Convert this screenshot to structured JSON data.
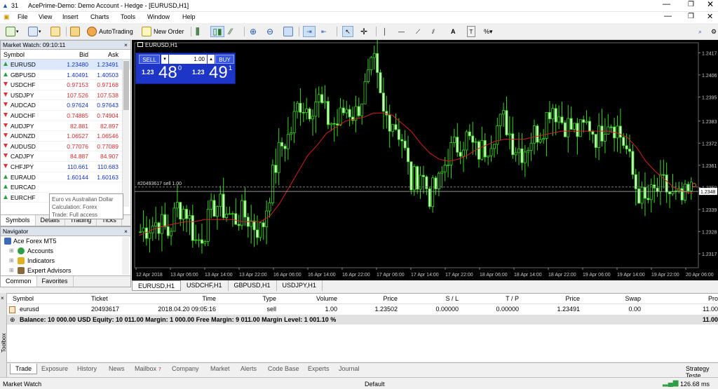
{
  "window": {
    "title": "AcePrime-Demo: Demo Account - Hedge - [EURUSD,H1]",
    "app_badge": "31"
  },
  "menu": [
    "File",
    "View",
    "Insert",
    "Charts",
    "Tools",
    "Window",
    "Help"
  ],
  "toolbar": {
    "autotrading": "AutoTrading",
    "new_order": "New Order"
  },
  "market_watch": {
    "title": "Market Watch: 09:10:11",
    "columns": {
      "symbol": "Symbol",
      "bid": "Bid",
      "ask": "Ask"
    },
    "rows": [
      {
        "symbol": "EURUSD",
        "bid": "1.23480",
        "ask": "1.23491",
        "dir": "up",
        "color": "blue"
      },
      {
        "symbol": "GBPUSD",
        "bid": "1.40491",
        "ask": "1.40503",
        "dir": "up",
        "color": "blue"
      },
      {
        "symbol": "USDCHF",
        "bid": "0.97153",
        "ask": "0.97168",
        "dir": "dn",
        "color": "red"
      },
      {
        "symbol": "USDJPY",
        "bid": "107.526",
        "ask": "107.538",
        "dir": "dn",
        "color": "red"
      },
      {
        "symbol": "AUDCAD",
        "bid": "0.97624",
        "ask": "0.97643",
        "dir": "dn",
        "color": "blue"
      },
      {
        "symbol": "AUDCHF",
        "bid": "0.74885",
        "ask": "0.74904",
        "dir": "dn",
        "color": "red"
      },
      {
        "symbol": "AUDJPY",
        "bid": "82.881",
        "ask": "82.897",
        "dir": "dn",
        "color": "red"
      },
      {
        "symbol": "AUDNZD",
        "bid": "1.06527",
        "ask": "1.06546",
        "dir": "dn",
        "color": "red"
      },
      {
        "symbol": "AUDUSD",
        "bid": "0.77076",
        "ask": "0.77089",
        "dir": "dn",
        "color": "red"
      },
      {
        "symbol": "CADJPY",
        "bid": "84.887",
        "ask": "84.907",
        "dir": "dn",
        "color": "red"
      },
      {
        "symbol": "CHFJPY",
        "bid": "110.661",
        "ask": "110.683",
        "dir": "dn",
        "color": "blue"
      },
      {
        "symbol": "EURAUD",
        "bid": "1.60144",
        "ask": "1.60163",
        "dir": "up",
        "color": "blue"
      },
      {
        "symbol": "EURCAD",
        "bid": "",
        "ask": "",
        "dir": "up",
        "color": "blue"
      },
      {
        "symbol": "EURCHF",
        "bid": "",
        "ask": "",
        "dir": "up",
        "color": "blue"
      }
    ],
    "tabs": [
      "Symbols",
      "Details",
      "Trading",
      "Ticks"
    ],
    "tooltip": [
      "Euro vs Australian Dollar",
      "Calculation: Forex",
      "Trade: Full access"
    ]
  },
  "navigator": {
    "title": "Navigator",
    "items": [
      "Ace Forex MT5",
      "Accounts",
      "Indicators",
      "Expert Advisors"
    ],
    "tabs": [
      "Common",
      "Favorites"
    ]
  },
  "chart": {
    "symbol_label": "EURUSD,H1",
    "sell_label": "SELL",
    "buy_label": "BUY",
    "volume": "1.00",
    "sell_small": "1.23",
    "sell_big": "48",
    "sell_sup": "0",
    "buy_small": "1.23",
    "buy_big": "49",
    "buy_sup": "1",
    "position_line_label": "#20493617 sell 1.00",
    "current_price": "1.2348"
  },
  "chart_data": {
    "type": "candlestick",
    "title": "EURUSD,H1",
    "x_tick_labels": [
      "12 Apr 2018",
      "13 Apr 06:00",
      "13 Apr 14:00",
      "13 Apr 22:00",
      "16 Apr 06:00",
      "16 Apr 14:00",
      "16 Apr 22:00",
      "17 Apr 06:00",
      "17 Apr 14:00",
      "17 Apr 22:00",
      "18 Apr 06:00",
      "18 Apr 14:00",
      "18 Apr 22:00",
      "19 Apr 06:00",
      "19 Apr 14:00",
      "19 Apr 22:00",
      "20 Apr 06:00"
    ],
    "y_tick_labels": [
      "1.2417",
      "1.2406",
      "1.2395",
      "1.2383",
      "1.2372",
      "1.2361",
      "1.2350",
      "1.2339",
      "1.2328",
      "1.2317"
    ],
    "ylim": [
      1.231,
      1.2422
    ],
    "position_price": 1.23502,
    "current_price": 1.2348,
    "close_path": [
      1.2328,
      1.2331,
      1.2333,
      1.2327,
      1.2341,
      1.2338,
      1.2322,
      1.233,
      1.2342,
      1.2339,
      1.2334,
      1.2337,
      1.2332,
      1.2328,
      1.2352,
      1.237,
      1.2376,
      1.2393,
      1.2389,
      1.2395,
      1.2384,
      1.2381,
      1.239,
      1.2386,
      1.2398,
      1.2412,
      1.2386,
      1.2384,
      1.2375,
      1.2352,
      1.2358,
      1.2346,
      1.2352,
      1.2367,
      1.2371,
      1.2375,
      1.2367,
      1.237,
      1.2379,
      1.2384,
      1.2371,
      1.2368,
      1.2376,
      1.2379,
      1.2392,
      1.2384,
      1.238,
      1.2377,
      1.2382,
      1.2374,
      1.2385,
      1.238,
      1.237,
      1.2351,
      1.2342,
      1.2347,
      1.2351,
      1.2345,
      1.2343,
      1.2348
    ],
    "ma_path": [
      1.2326,
      1.2328,
      1.233,
      1.2331,
      1.2332,
      1.2333,
      1.2333,
      1.2334,
      1.2334,
      1.2334,
      1.2334,
      1.2333,
      1.2333,
      1.2333,
      1.2336,
      1.2342,
      1.235,
      1.2358,
      1.2366,
      1.2371,
      1.2377,
      1.238,
      1.2383,
      1.2384,
      1.2385,
      1.2387,
      1.2387,
      1.2386,
      1.2382,
      1.2378,
      1.2372,
      1.2367,
      1.2364,
      1.2363,
      1.2364,
      1.2366,
      1.2369,
      1.2371,
      1.2373,
      1.2374,
      1.2374,
      1.2374,
      1.2375,
      1.2376,
      1.2377,
      1.2378,
      1.2378,
      1.2378,
      1.2378,
      1.2378,
      1.2378,
      1.2377,
      1.2375,
      1.237,
      1.2363,
      1.2358,
      1.2354,
      1.235,
      1.2348,
      1.2347
    ]
  },
  "chart_tabs": [
    "EURUSD,H1",
    "USDCHF,H1",
    "GBPUSD,H1",
    "USDJPY,H1"
  ],
  "terminal": {
    "columns": [
      "Symbol",
      "Ticket",
      "Time",
      "Type",
      "Volume",
      "Price",
      "S / L",
      "T / P",
      "Price",
      "Swap",
      "Pro"
    ],
    "rows": [
      [
        "eurusd",
        "20493617",
        "2018.04.20 09:05:16",
        "sell",
        "1.00",
        "1.23502",
        "0.00000",
        "0.00000",
        "1.23491",
        "0.00",
        "11.00"
      ]
    ],
    "balance_line": "Balance: 10 000.00 USD  Equity: 10 011.00  Margin: 1 000.00  Free Margin: 9 011.00  Margin Level: 1 001.10 %",
    "balance_profit": "11.00",
    "tabs": [
      "Trade",
      "Exposure",
      "History",
      "News",
      "Mailbox",
      "Company",
      "Market",
      "Alerts",
      "Code Base",
      "Experts",
      "Journal"
    ],
    "mailbox_badge": "7",
    "strategy_tester": "Strategy Teste",
    "toolbox_label": "Toolbox"
  },
  "status": {
    "left": "Market Watch",
    "center": "Default",
    "traffic": "126.68 ms"
  }
}
